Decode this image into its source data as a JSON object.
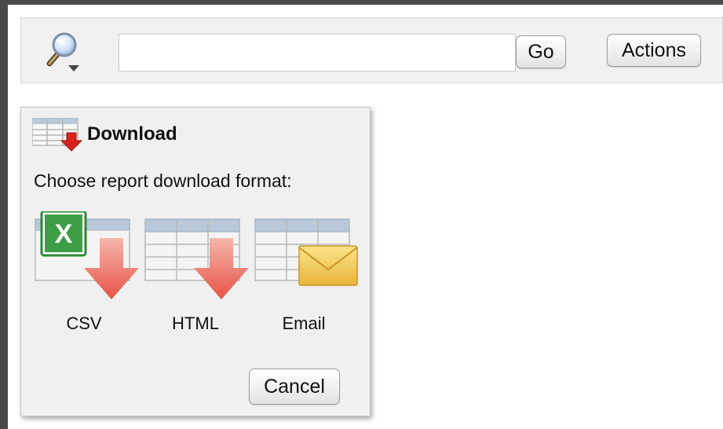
{
  "toolbar": {
    "search_icon": "magnifier-with-dropdown-icon",
    "search_value": "",
    "search_placeholder": "",
    "go_label": "Go",
    "actions_label": "Actions"
  },
  "download_panel": {
    "title": "Download",
    "title_icon": "table-download-icon",
    "description": "Choose report download format:",
    "formats": [
      {
        "label": "CSV",
        "icon": "excel-table-download-icon"
      },
      {
        "label": "HTML",
        "icon": "html-table-download-icon"
      },
      {
        "label": "Email",
        "icon": "table-email-icon"
      }
    ],
    "cancel_label": "Cancel"
  },
  "colors": {
    "toolbar_bg": "#f1f1f1",
    "panel_bg": "#f0f0f0",
    "arrow_red": "#e64b3c",
    "excel_green": "#2d8a34",
    "envelope_yellow": "#f2c84b",
    "table_header_blue": "#b8c8d8"
  }
}
